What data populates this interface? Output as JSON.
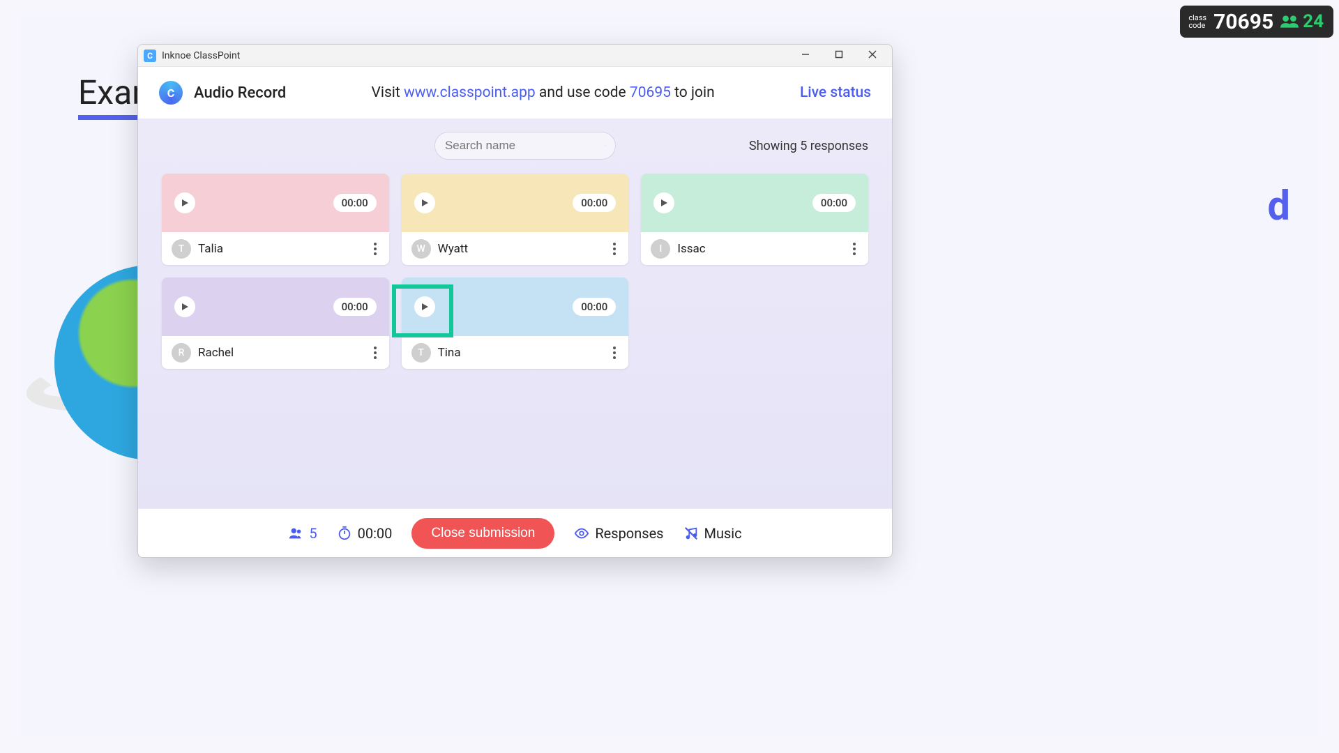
{
  "background": {
    "title_fragment": "Exam",
    "side_fragment": "d"
  },
  "class_pill": {
    "label1": "class",
    "label2": "code",
    "code": "70695",
    "participants": "24"
  },
  "window": {
    "title": "Inknoe ClassPoint"
  },
  "header": {
    "logo_letter": "C",
    "title": "Audio Record",
    "visit_prefix": "Visit ",
    "url": "www.classpoint.app",
    "visit_mid": " and use code ",
    "code": "70695",
    "visit_suffix": " to join",
    "live_status": "Live status"
  },
  "search": {
    "placeholder": "Search name"
  },
  "showing": "Showing 5 responses",
  "cards": [
    {
      "color": "c-pink",
      "time": "00:00",
      "initial": "T",
      "name": "Talia"
    },
    {
      "color": "c-yellow",
      "time": "00:00",
      "initial": "W",
      "name": "Wyatt"
    },
    {
      "color": "c-green",
      "time": "00:00",
      "initial": "I",
      "name": "Issac"
    },
    {
      "color": "c-purple",
      "time": "00:00",
      "initial": "R",
      "name": "Rachel"
    },
    {
      "color": "c-blue",
      "time": "00:00",
      "initial": "T",
      "name": "Tina"
    }
  ],
  "footer": {
    "responses_count": "5",
    "timer": "00:00",
    "close_label": "Close submission",
    "responses_label": "Responses",
    "music_label": "Music"
  }
}
